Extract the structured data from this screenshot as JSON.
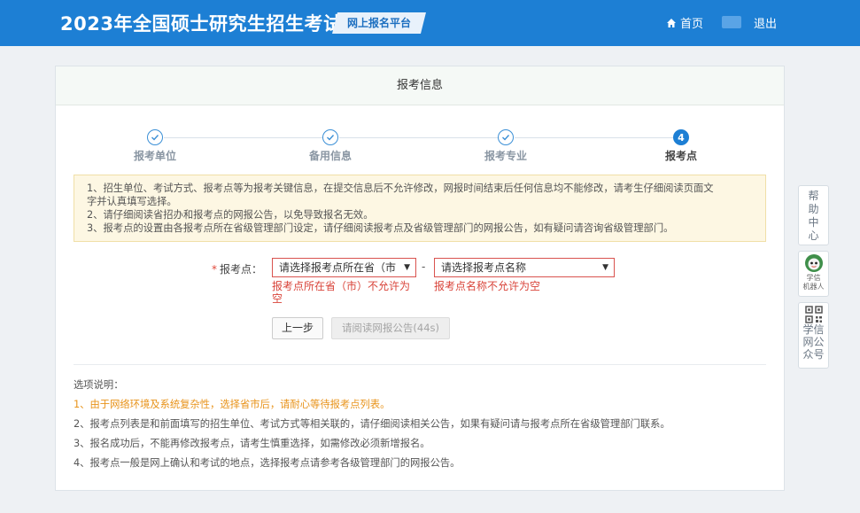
{
  "header": {
    "title": "2023年全国硕士研究生招生考试",
    "platform": "网上报名平台",
    "home_label": "首页",
    "logout_label": "退出"
  },
  "panel": {
    "title": "报考信息"
  },
  "steps": [
    {
      "label": "报考单位",
      "status": "done"
    },
    {
      "label": "备用信息",
      "status": "done"
    },
    {
      "label": "报考专业",
      "status": "done"
    },
    {
      "label": "报考点",
      "status": "active",
      "number": "4"
    }
  ],
  "notice": {
    "line1": "1、招生单位、考试方式、报考点等为报考关键信息，在提交信息后不允许修改，网报时间结束后任何信息均不能修改，请考生仔细阅读页面文",
    "line1b": "字并认真填写选择。",
    "line2": "2、请仔细阅读省招办和报考点的网报公告，以免导致报名无效。",
    "line3": "3、报考点的设置由各报考点所在省级管理部门设定，请仔细阅读报考点及省级管理部门的网报公告，如有疑问请咨询省级管理部门。"
  },
  "form": {
    "required_mark": "*",
    "label": "报考点：",
    "province_value": "请选择报考点所在省（市",
    "separator": "-",
    "site_value": "请选择报考点名称",
    "province_error_1": "报考点所在省（市）不允许为",
    "province_error_2": "空",
    "site_error": "报考点名称不允许为空"
  },
  "buttons": {
    "prev": "上一步",
    "read": "请阅读网报公告(44s)"
  },
  "notes": {
    "title": "选项说明：",
    "item1": "1、由于网络环境及系统复杂性，选择省市后，请耐心等待报考点列表。",
    "item2": "2、报考点列表是和前面填写的招生单位、考试方式等相关联的，请仔细阅读相关公告，如果有疑问请与报考点所在省级管理部门联系。",
    "item3": "3、报名成功后，不能再修改报考点，请考生慎重选择，如需修改必须新增报名。",
    "item4": "4、报考点一般是网上确认和考试的地点，选择报考点请参考各级管理部门的网报公告。"
  },
  "sidebar": {
    "help": [
      "帮",
      "助",
      "中",
      "心"
    ],
    "robot_1": "学信",
    "robot_2": "机器人",
    "wechat": [
      "学信",
      "网公",
      "众号"
    ]
  },
  "colors": {
    "header_bg": "#1d7fd4",
    "error": "#d9443a",
    "highlight": "#e8931a",
    "notice_bg": "#fdf7e3"
  }
}
